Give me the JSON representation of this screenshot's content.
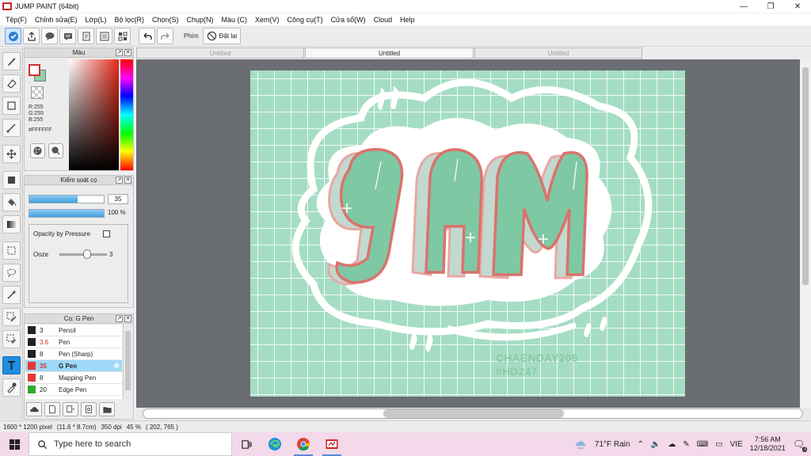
{
  "window": {
    "title": "JUMP PAINT (64bit)",
    "controls": [
      "—",
      "❐",
      "✕"
    ]
  },
  "menu": [
    "Tệp(F)",
    "Chỉnh sửa(E)",
    "Lớp(L)",
    "Bộ lọc(R)",
    "Chọn(S)",
    "Chụp(N)",
    "Màu (C)",
    "Xem(V)",
    "Công cụ(T)",
    "Cửa sổ(W)",
    "Cloud",
    "Help"
  ],
  "toolbar": {
    "phim_label": "Phím",
    "reset_label": "Đặt lại"
  },
  "color_panel": {
    "title": "Màu",
    "rgb": [
      "R:255",
      "G:255",
      "B:255"
    ],
    "hex": "#FFFFFF",
    "fg_color": "#ffffff",
    "bg_color": "#8fd0a8"
  },
  "brush_control": {
    "title": "Kiểm soát cọ",
    "size_value": "35",
    "size_fraction": 0.65,
    "opacity_value": "100 %",
    "opacity_fraction": 1.0,
    "opacity_by_pressure_label": "Opacity by Pressure",
    "ooze_label": "Ooze",
    "ooze_value": "3"
  },
  "brush_list": {
    "title": "Cọ: G Pen",
    "items": [
      {
        "size": "3",
        "name": "Pencil",
        "color": "#222222",
        "selected": false
      },
      {
        "size": "3.6",
        "name": "Pen",
        "color": "#222222",
        "selected": false
      },
      {
        "size": "8",
        "name": "Pen (Sharp)",
        "color": "#222222",
        "selected": false
      },
      {
        "size": "35",
        "name": "G Pen",
        "color": "#e53935",
        "selected": true
      },
      {
        "size": "8",
        "name": "Mapping Pen",
        "color": "#e53935",
        "selected": false
      },
      {
        "size": "20",
        "name": "Edge Pen",
        "color": "#2eaa2e",
        "selected": false
      }
    ]
  },
  "tabs": [
    "Untitled",
    "Untitled",
    "Untitled"
  ],
  "artwork": {
    "signature_line1": "CHAENDAY208",
    "signature_line2": "#HD247"
  },
  "status": {
    "size": "1600 * 1200 pixel",
    "physical": "(11.6 * 8.7cm)",
    "dpi": "350 dpi",
    "zoom": "45 %",
    "coords": "( 202, 765 )"
  },
  "taskbar": {
    "search_placeholder": "Type here to search",
    "weather": "71°F  Rain",
    "lang": "VIE",
    "time": "7:56 AM",
    "date": "12/18/2021",
    "notif_count": "3"
  }
}
